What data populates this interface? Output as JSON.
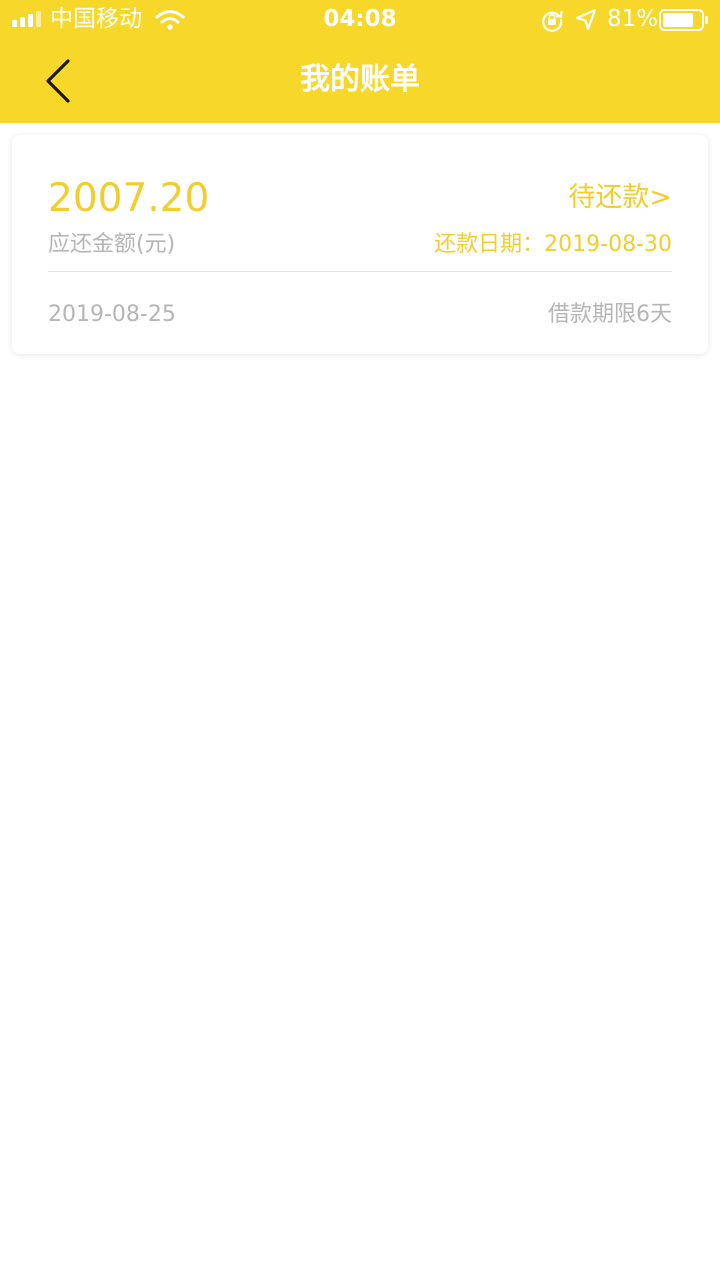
{
  "status_bar": {
    "carrier": "中国移动",
    "time": "04:08",
    "battery_percent": "81%",
    "battery_level": 0.81
  },
  "nav": {
    "title": "我的账单"
  },
  "bill": {
    "amount": "2007.20",
    "amount_label": "应还金额(元)",
    "status": "待还款>",
    "due_date_label": "还款日期：",
    "due_date": "2019-08-30",
    "loan_date": "2019-08-25",
    "loan_term": "借款期限6天"
  },
  "colors": {
    "header_bg": "#F7D82A",
    "accent": "#F2CD2E",
    "muted_text": "#b5b5b5",
    "icons": [
      "signal-icon",
      "wifi-icon",
      "rotation-lock-icon",
      "location-arrow-icon",
      "battery-icon",
      "back-chevron-icon"
    ]
  }
}
